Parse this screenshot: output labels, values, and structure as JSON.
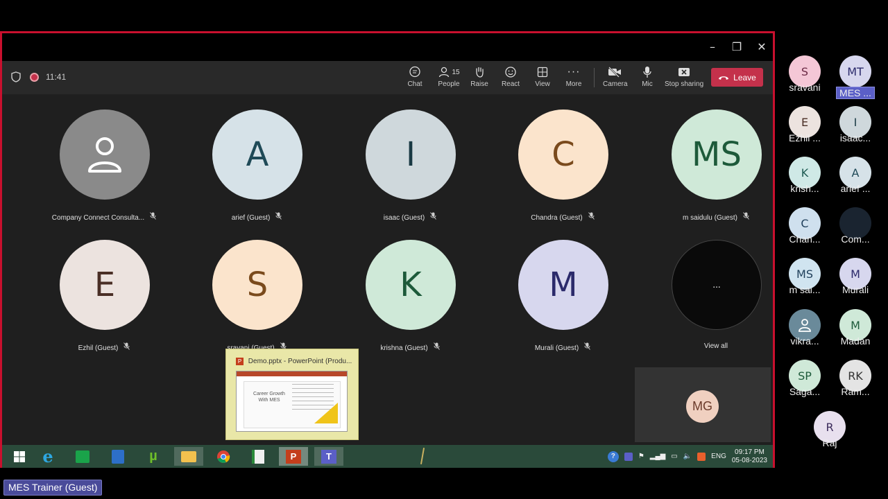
{
  "meeting": {
    "timer": "11:41",
    "toolbar": {
      "chat": "Chat",
      "people": "People",
      "people_count": "15",
      "raise": "Raise",
      "react": "React",
      "view": "View",
      "more": "More",
      "camera": "Camera",
      "mic": "Mic",
      "stop_sharing": "Stop sharing",
      "leave": "Leave"
    },
    "tiles": [
      {
        "initials": "",
        "name": "Company Connect Consulta...",
        "bg": "#8a8a8a",
        "fg": "#ffffff",
        "icon": "person-icon"
      },
      {
        "initials": "A",
        "name": "arief (Guest)",
        "bg": "#d6e2e8",
        "fg": "#1f4a57"
      },
      {
        "initials": "I",
        "name": "isaac (Guest)",
        "bg": "#cfd8dc",
        "fg": "#1a3a44"
      },
      {
        "initials": "C",
        "name": "Chandra (Guest)",
        "bg": "#fbe4cc",
        "fg": "#7a4a1c"
      },
      {
        "initials": "MS",
        "name": "m saidulu (Guest)",
        "bg": "#cfe9d8",
        "fg": "#1d5a3a"
      },
      {
        "initials": "E",
        "name": "Ezhil (Guest)",
        "bg": "#ece3df",
        "fg": "#4a2f26"
      },
      {
        "initials": "S",
        "name": "sravani (Guest)",
        "bg": "#fbe4cc",
        "fg": "#7a4a1c"
      },
      {
        "initials": "K",
        "name": "krishna (Guest)",
        "bg": "#cfe9d8",
        "fg": "#1d5a3a"
      },
      {
        "initials": "M",
        "name": "Murali (Guest)",
        "bg": "#d7d7ee",
        "fg": "#2b2a6b"
      },
      {
        "initials": "...",
        "name": "View all",
        "bg": "#0a0a0a",
        "fg": "#ffffff"
      }
    ],
    "popup": {
      "title": "Demo.pptx - PowerPoint (Produ...",
      "slide_text": "Career Growth With MES"
    },
    "self_view": {
      "initials": "MG"
    }
  },
  "taskbar": {
    "lang": "ENG",
    "time": "09:17 PM",
    "date": "05-08-2023",
    "apps": [
      "windows-start-icon",
      "internet-explorer-icon",
      "store-icon",
      "notepad-icon",
      "utorrent-icon",
      "file-explorer-icon",
      "chrome-icon",
      "spreadsheet-icon",
      "powerpoint-icon",
      "teams-icon"
    ]
  },
  "gallery": [
    {
      "initials": "S",
      "name": "sravani",
      "bg": "#f4c7d6",
      "fg": "#6b2a45"
    },
    {
      "initials": "MT",
      "name": "MES ...",
      "bg": "#d7d7ee",
      "fg": "#2b2a6b",
      "highlight": true
    },
    {
      "initials": "E",
      "name": "Ezhil ...",
      "bg": "#ece3df",
      "fg": "#4a2f26"
    },
    {
      "initials": "I",
      "name": "isaac...",
      "bg": "#cfd8dc",
      "fg": "#1a3a44"
    },
    {
      "initials": "K",
      "name": "krish...",
      "bg": "#cfe9e6",
      "fg": "#1d5a52"
    },
    {
      "initials": "A",
      "name": "arief ...",
      "bg": "#d6e2e8",
      "fg": "#1f4a57"
    },
    {
      "initials": "C",
      "name": "Chan...",
      "bg": "#cfe0ee",
      "fg": "#1f3f5a"
    },
    {
      "initials": "",
      "name": "Com...",
      "bg": "#1a2430",
      "fg": "#ffffff"
    },
    {
      "initials": "MS",
      "name": "m sai...",
      "bg": "#d0e4f0",
      "fg": "#1f3f5a"
    },
    {
      "initials": "M",
      "name": "Murali",
      "bg": "#d7d7ee",
      "fg": "#2b2a6b"
    },
    {
      "initials": "",
      "name": "vikra...",
      "bg": "#6a8a9a",
      "fg": "#ffffff",
      "icon": "person-icon"
    },
    {
      "initials": "M",
      "name": "Madan",
      "bg": "#cfe9d8",
      "fg": "#1d5a3a"
    },
    {
      "initials": "SP",
      "name": "Saga...",
      "bg": "#cfe9d8",
      "fg": "#1d5a3a"
    },
    {
      "initials": "RK",
      "name": "Ram...",
      "bg": "#e4e4e4",
      "fg": "#333333"
    },
    {
      "initials": "R",
      "name": "Raj",
      "bg": "#e8e0ee",
      "fg": "#3a2a5a"
    }
  ],
  "caption": {
    "label": "MES Trainer (Guest)"
  }
}
